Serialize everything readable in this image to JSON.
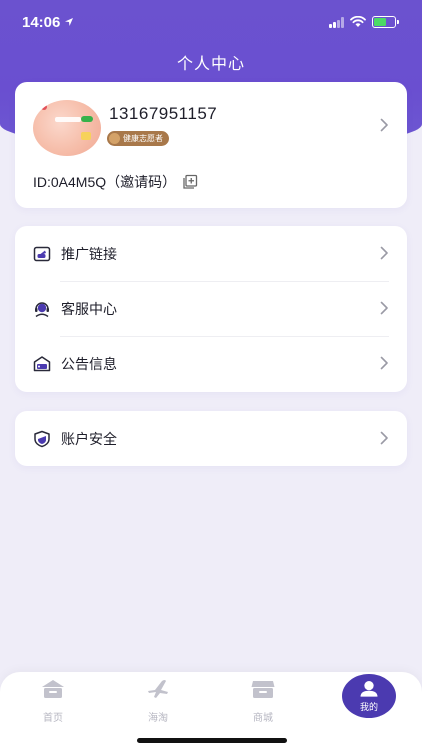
{
  "status_bar": {
    "time": "14:06"
  },
  "header": {
    "title": "个人中心"
  },
  "profile": {
    "phone": "13167951157",
    "badge": "健康志愿者",
    "invite_text": "ID:0A4M5Q（邀请码）"
  },
  "menu": {
    "items": [
      {
        "label": "推广链接",
        "icon": "share-card-icon"
      },
      {
        "label": "客服中心",
        "icon": "headset-icon"
      },
      {
        "label": "公告信息",
        "icon": "announcement-icon"
      }
    ]
  },
  "security": {
    "label": "账户安全",
    "icon": "shield-icon"
  },
  "tabbar": {
    "tabs": [
      {
        "label": "首页",
        "icon": "home-icon",
        "active": false
      },
      {
        "label": "海淘",
        "icon": "plane-icon",
        "active": false
      },
      {
        "label": "商城",
        "icon": "store-icon",
        "active": false
      },
      {
        "label": "我的",
        "icon": "user-icon",
        "active": true
      }
    ]
  },
  "colors": {
    "accent": "#6a4fd0",
    "active_tab": "#4b3ab0",
    "badge": "#a8784a"
  }
}
